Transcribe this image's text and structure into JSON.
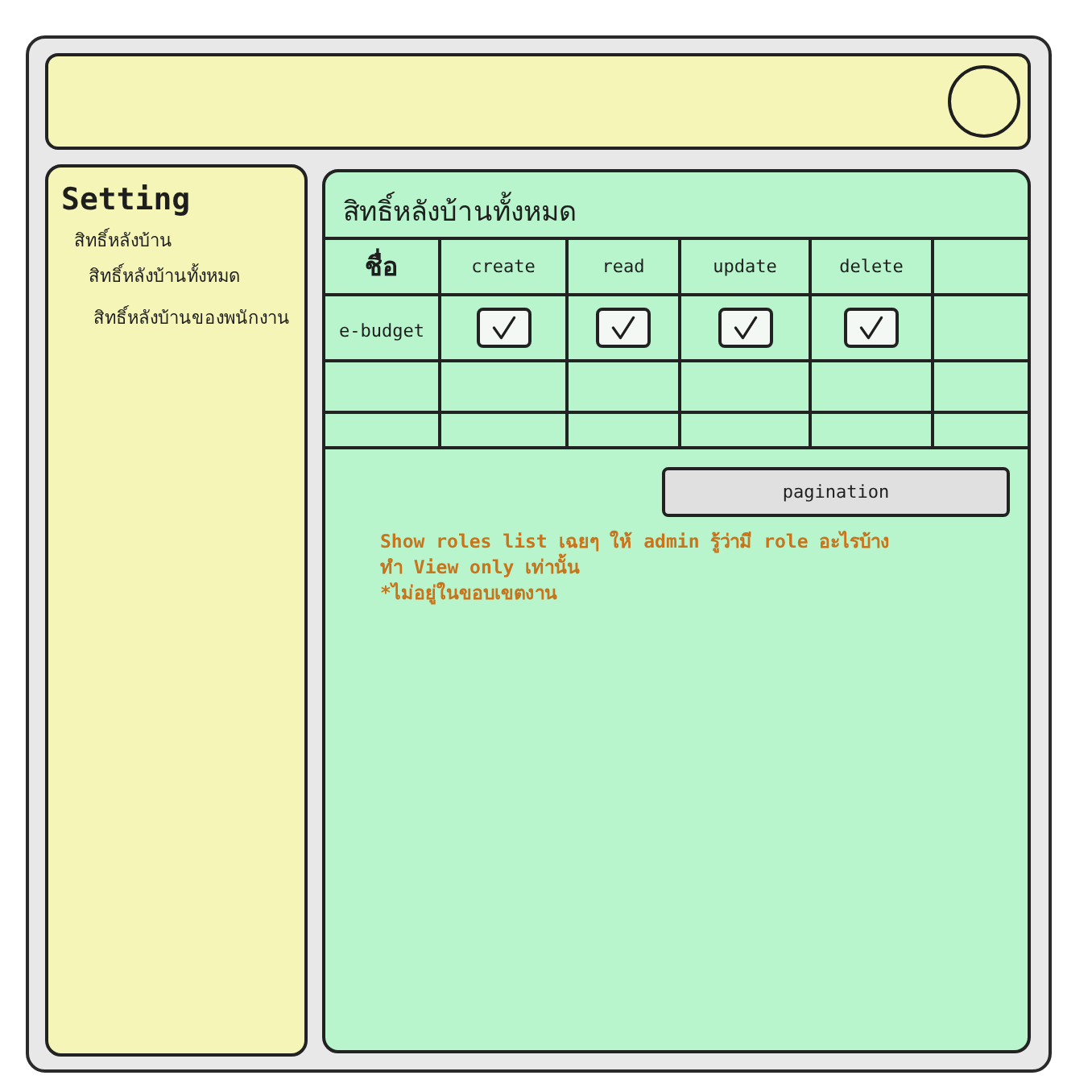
{
  "sidebar": {
    "title": "Setting",
    "items": [
      {
        "label": "สิทธิ์หลังบ้าน",
        "children": [
          {
            "label": "สิทธิ์หลังบ้านทั้งหมด"
          },
          {
            "label": "สิทธิ์หลังบ้านของพนักงาน"
          }
        ]
      }
    ]
  },
  "main": {
    "title": "สิทธิ์หลังบ้านทั้งหมด",
    "table": {
      "columns": [
        "ชื่อ",
        "create",
        "read",
        "update",
        "delete"
      ],
      "rows": [
        {
          "name": "e-budget",
          "permissions": [
            {
              "checked": true
            },
            {
              "checked": true
            },
            {
              "checked": true
            },
            {
              "checked": true
            }
          ]
        }
      ]
    },
    "pagination": {
      "label": "pagination"
    },
    "note": [
      "Show roles list เฉยๆ ให้ admin รู้ว่ามี role อะไรบ้าง",
      "ทำ View only เท่านั้น",
      "*ไม่อยู่ในขอบเขตงาน"
    ]
  }
}
